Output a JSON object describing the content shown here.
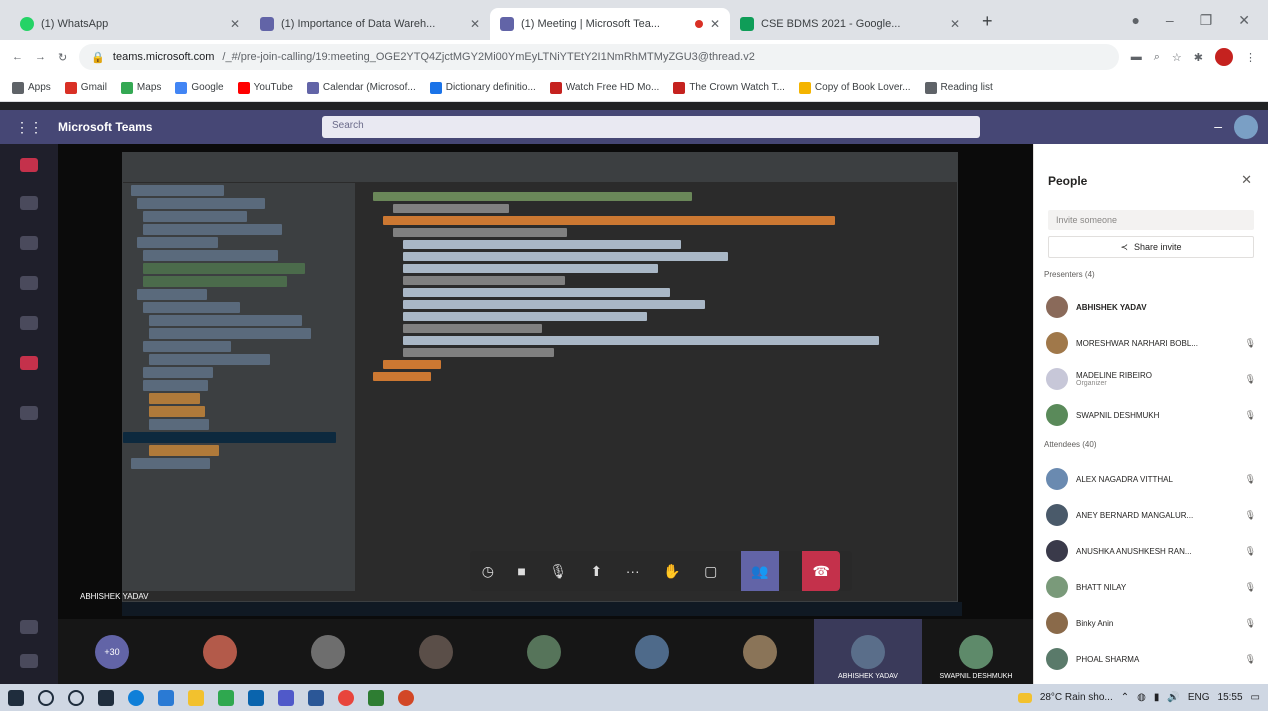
{
  "browser": {
    "tabs": [
      {
        "title": "(1) WhatsApp",
        "color": "#25d366",
        "active": false
      },
      {
        "title": "(1) Importance of Data Wareh...",
        "color": "#6264a7",
        "active": false
      },
      {
        "title": "(1) Meeting | Microsoft Tea...",
        "color": "#6264a7",
        "active": true
      },
      {
        "title": "CSE BDMS 2021 - Google...",
        "color": "#0f9d58",
        "active": false
      }
    ],
    "new_tab": "+",
    "url_host": "teams.microsoft.com",
    "url_path": "/_#/pre-join-calling/19:meeting_OGE2YTQ4ZjctMGY2Mi00YmEyLTNiYTEtY2I1NmRhMTMyZGU3@thread.v2",
    "bookmarks": [
      {
        "label": "Apps",
        "color": "#5f6368"
      },
      {
        "label": "Gmail",
        "color": "#d93025"
      },
      {
        "label": "Maps",
        "color": "#34a853"
      },
      {
        "label": "Google",
        "color": "#4285f4"
      },
      {
        "label": "YouTube",
        "color": "#ff0000"
      },
      {
        "label": "Calendar (Microsof...",
        "color": "#6264a7"
      },
      {
        "label": "Dictionary definitio...",
        "color": "#1a73e8"
      },
      {
        "label": "Watch Free HD Mo...",
        "color": "#c5221f"
      },
      {
        "label": "The Crown Watch T...",
        "color": "#c5221f"
      },
      {
        "label": "Copy of Book Lover...",
        "color": "#f4b400"
      },
      {
        "label": "Reading list",
        "color": "#5f6368"
      }
    ]
  },
  "teams": {
    "app_title": "Microsoft Teams",
    "search_placeholder": "Search",
    "minimize": "–"
  },
  "meeting": {
    "presenter_label": "ABHISHEK YADAV",
    "controls": [
      "timer-icon",
      "camera-icon",
      "mic-icon",
      "share-icon",
      "more-icon",
      "raise-hand-icon",
      "chat-icon",
      "people-icon",
      "hangup-icon"
    ],
    "gallery": [
      {
        "name": "",
        "color": "#6264a7",
        "initials": "+30"
      },
      {
        "name": "",
        "color": "#b35a4a"
      },
      {
        "name": "",
        "color": "#6e6e6e"
      },
      {
        "name": "",
        "color": "#5a4e48"
      },
      {
        "name": "",
        "color": "#56745a"
      },
      {
        "name": "",
        "color": "#4e6a8a"
      },
      {
        "name": "",
        "color": "#8a7458"
      },
      {
        "name": "ABHISHEK YADAV",
        "color": "#5a6e8a"
      },
      {
        "name": "SWAPNIL DESHMUKH",
        "color": "#5e8a6a"
      }
    ]
  },
  "people_panel": {
    "title": "People",
    "invite_placeholder": "Invite someone",
    "share_invite": "Share invite",
    "presenters_header": "Presenters (4)",
    "attendees_header": "Attendees (40)",
    "presenters": [
      {
        "name": "ABHISHEK YADAV",
        "sub": "",
        "color": "#8a6a5a"
      },
      {
        "name": "MORESHWAR NARHARI BOBL...",
        "sub": "",
        "color": "#a0784a"
      },
      {
        "name": "MADELINE RIBEIRO",
        "sub": "Organizer",
        "color": "#c7c7d8"
      },
      {
        "name": "SWAPNIL DESHMUKH",
        "sub": "",
        "color": "#5a8a5a"
      }
    ],
    "attendees": [
      {
        "name": "ALEX NAGADRA VITTHAL",
        "color": "#6a8ab0"
      },
      {
        "name": "ANEY BERNARD MANGALUR...",
        "color": "#4a5a6a"
      },
      {
        "name": "ANUSHKA ANUSHKESH RAN...",
        "color": "#3a3a4a"
      },
      {
        "name": "BHATT NILAY",
        "color": "#7a9a7a"
      },
      {
        "name": "Binky Anin",
        "color": "#8a6a4a"
      },
      {
        "name": "PHOAL SHARMA",
        "color": "#5a7a6a"
      }
    ]
  },
  "taskbar": {
    "weather": "28°C Rain sho...",
    "lang": "ENG",
    "time": "15:55"
  }
}
